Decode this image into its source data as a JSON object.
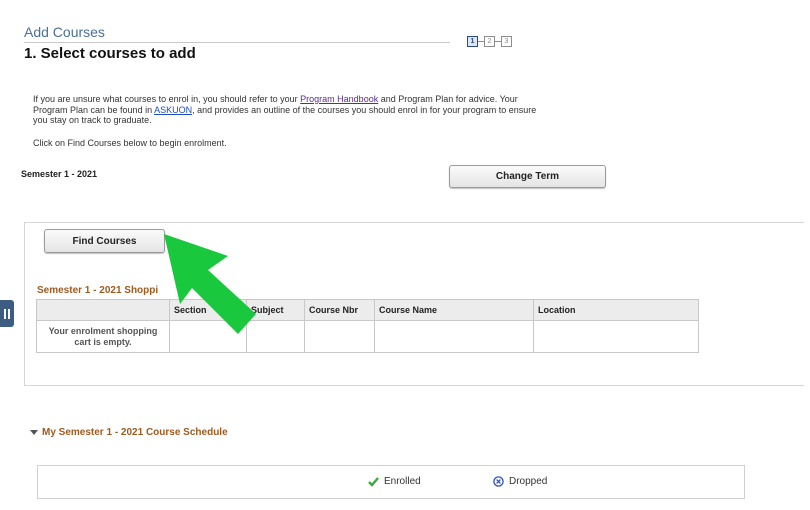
{
  "header": {
    "page_title": "Add Courses",
    "step_title": "1.  Select courses to add",
    "steps": [
      "1",
      "2",
      "3"
    ],
    "active_step": 1
  },
  "intro": {
    "p1_before_link1": "If you are unsure what courses to enrol in, you should refer to your ",
    "link_handbook": "Program Handbook",
    "p1_after_link1": " and Program Plan for advice. Your Program Plan can be found in ",
    "link_askuon": "ASKUON",
    "p1_after_link2": ", and provides an outline of the courses you should enrol in for your program to ensure you stay on track to graduate.",
    "click_info": "Click on Find Courses below to begin enrolment."
  },
  "term": {
    "label": "Semester 1 - 2021",
    "change_term_button": "Change Term"
  },
  "cart": {
    "find_courses_button": "Find Courses",
    "heading": "Semester 1 - 2021 Shoppi",
    "columns": [
      "",
      "Section",
      "Subject",
      "Course Nbr",
      "Course Name",
      "Location"
    ],
    "empty_message": "Your enrolment shopping cart is empty."
  },
  "schedule": {
    "heading": "My Semester 1 - 2021 Course Schedule",
    "legend": {
      "enrolled": "Enrolled",
      "dropped": "Dropped",
      "enrolled_icon": "check-icon",
      "dropped_icon": "circle-x-icon",
      "enrolled_color": "#3aa93a",
      "dropped_color": "#2d4fc4"
    }
  },
  "colors": {
    "accent_orange": "#a05a1e",
    "header_blue": "#4a6f9a",
    "arrow_green": "#19c83c",
    "side_tab": "#3d5c82"
  }
}
